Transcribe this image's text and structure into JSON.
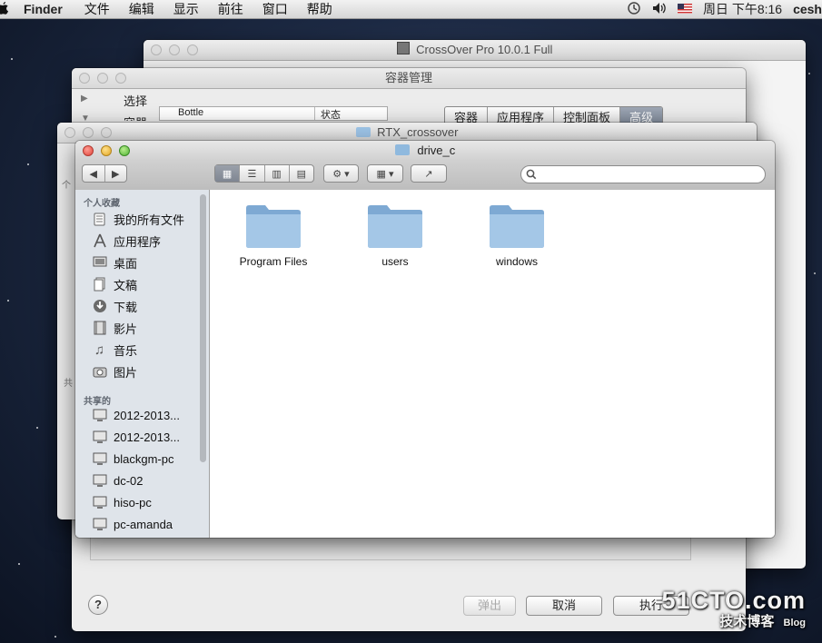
{
  "menubar": {
    "app_name": "Finder",
    "items": [
      "文件",
      "编辑",
      "显示",
      "前往",
      "窗口",
      "帮助"
    ],
    "clock": "周日 下午8:16",
    "user": "cesh"
  },
  "crossover_window": {
    "title": "CrossOver Pro 10.0.1 Full"
  },
  "containers_window": {
    "title": "容器管理",
    "list_items": [
      "选择",
      "容器"
    ],
    "table_headers": [
      "Bottle",
      "状态"
    ],
    "tabs": [
      "容器",
      "应用程序",
      "控制面板",
      "高级"
    ],
    "selected_tab": "高级",
    "side_labels": [
      "个",
      "共"
    ],
    "buttons": {
      "eject": "弹出",
      "cancel": "取消",
      "execute": "执行",
      "help": "?"
    }
  },
  "rtx_window": {
    "title": "RTX_crossover"
  },
  "finder_window": {
    "title": "drive_c",
    "sidebar": {
      "favorites_header": "个人收藏",
      "favorites": [
        {
          "label": "我的所有文件",
          "icon": "all-files-icon"
        },
        {
          "label": "应用程序",
          "icon": "applications-icon"
        },
        {
          "label": "桌面",
          "icon": "desktop-icon"
        },
        {
          "label": "文稿",
          "icon": "documents-icon"
        },
        {
          "label": "下载",
          "icon": "downloads-icon"
        },
        {
          "label": "影片",
          "icon": "movies-icon"
        },
        {
          "label": "音乐",
          "icon": "music-icon"
        },
        {
          "label": "图片",
          "icon": "pictures-icon"
        }
      ],
      "shared_header": "共享的",
      "shared": [
        {
          "label": "2012-2013...",
          "icon": "computer-icon"
        },
        {
          "label": "2012-2013...",
          "icon": "computer-icon"
        },
        {
          "label": "blackgm-pc",
          "icon": "computer-icon"
        },
        {
          "label": "dc-02",
          "icon": "computer-icon"
        },
        {
          "label": "hiso-pc",
          "icon": "computer-icon"
        },
        {
          "label": "pc-amanda",
          "icon": "computer-icon"
        }
      ]
    },
    "folders": [
      "Program Files",
      "users",
      "windows"
    ]
  },
  "watermark": {
    "big": "51CTO.com",
    "small": "技术博客",
    "tag": "Blog"
  },
  "colors": {
    "accent_selected_tab": "#7d8898",
    "folder_blue": "#8fb9de",
    "sidebar_bg": "#dfe4ea"
  }
}
